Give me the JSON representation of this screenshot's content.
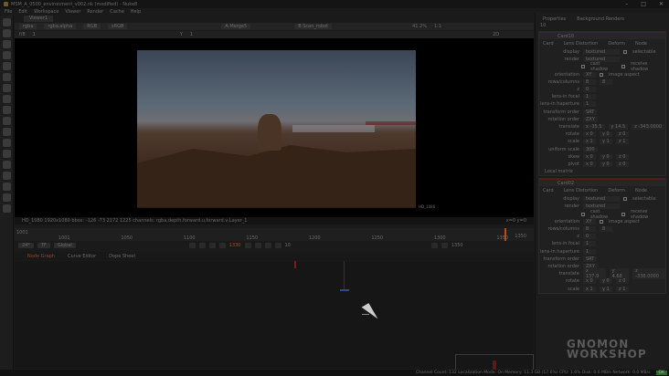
{
  "window": {
    "title": "MSM_A_0500_environment_v002.nk (modified) - Nuke8",
    "controls": [
      "–",
      "□",
      "✕"
    ]
  },
  "menu": [
    "File",
    "Edit",
    "Workspace",
    "Viewer",
    "Render",
    "Cache",
    "Help"
  ],
  "viewer": {
    "tab": "Viewer1",
    "channels": "rgba",
    "alpha": "rgba.alpha",
    "color": "RGB",
    "lut": "sRGB",
    "input_a": "A  Merge5",
    "input_b": "B  Scan_robot",
    "zoom": "41.2%",
    "ratio": "1:1",
    "mode": "2D",
    "gain": "f/8",
    "gain_val": "1",
    "gamma_label": "Y",
    "gamma_val": "1",
    "info": "HD_1080 1920x1080  bbox: -126 -73 2172 1225 channels: rgba,depth,forward.u,forward.v,Layer_1",
    "coords": "x=0 y=0",
    "format_label": "HD_1080"
  },
  "timeline": {
    "start": "1001",
    "ticks": [
      "1001",
      "1050",
      "1100",
      "1150",
      "1200",
      "1250",
      "1300",
      "1350"
    ],
    "end": "1350",
    "fps": "24*",
    "tf": "TF",
    "scope": "Global",
    "current_frame": "1330",
    "step": "10"
  },
  "node_graph": {
    "tabs": [
      "Node Graph",
      "Curve Editor",
      "Dope Sheet"
    ]
  },
  "properties": {
    "tabs": [
      "Properties",
      "Background Renders"
    ],
    "count": "10",
    "panels": [
      {
        "name": "Card10",
        "subtabs": [
          "Card",
          "Lens Distortion",
          "Deform",
          "Node"
        ],
        "display": "textured",
        "render": "textured",
        "selectable": "selectable",
        "cast_shadow": "cast shadow",
        "receive_shadow": "receive shadow",
        "orientation": "XY",
        "image_aspect": "image aspect",
        "rows": "8",
        "cols": "8",
        "z": "0",
        "lens_focal": "1",
        "lens_haperture": "1",
        "transform_order": "SRT",
        "rotation_order": "ZXY",
        "translate": [
          "x -35.5",
          "y 14.5",
          "z -343.0000"
        ],
        "rotate": [
          "x 0",
          "y 0",
          "z 0"
        ],
        "scale": [
          "x 1",
          "y 1",
          "z 1"
        ],
        "uniform_scale": "300",
        "skew": [
          "x 0",
          "y 0",
          "z 0"
        ],
        "pivot": [
          "x 0",
          "y 0",
          "z 0"
        ],
        "local_matrix": "Local matrix"
      },
      {
        "name": "Card02",
        "subtabs": [
          "Card",
          "Lens Distortion",
          "Deform",
          "Node"
        ],
        "display": "textured",
        "render": "textured",
        "selectable": "selectable",
        "cast_shadow": "cast shadow",
        "receive_shadow": "receive shadow",
        "orientation": "XY",
        "image_aspect": "image aspect",
        "rows": "8",
        "cols": "8",
        "z": "0",
        "lens_focal": "1",
        "lens_haperture": "1",
        "transform_order": "SRT",
        "rotation_order": "ZXY",
        "translate": [
          "x 137.9",
          "y 4.68",
          "z -338.0000"
        ],
        "rotate": [
          "x 0",
          "y 0",
          "z 0"
        ],
        "scale": [
          "x 1",
          "y 1",
          "z 1"
        ]
      }
    ],
    "labels": {
      "display": "display",
      "render": "render",
      "orientation": "orientation",
      "rows": "rows/columns",
      "z": "z",
      "lens_focal": "lens-in focal",
      "lens_haperture": "lens-in haperture",
      "transform_order": "transform order",
      "rotation_order": "rotation order",
      "translate": "translate",
      "rotate": "rotate",
      "scale": "scale",
      "uniform_scale": "uniform scale",
      "skew": "skew",
      "pivot": "pivot"
    }
  },
  "status": {
    "text": "Channel Count: 132  Localization Mode: On  Memory: 11.3 GB (17.6%)  CPU: 1.6%  Disk: 0.0 MB/s  Network: 0.0 MB/s",
    "ok": "OK"
  },
  "watermark": "GNOMON WORKSHOP"
}
